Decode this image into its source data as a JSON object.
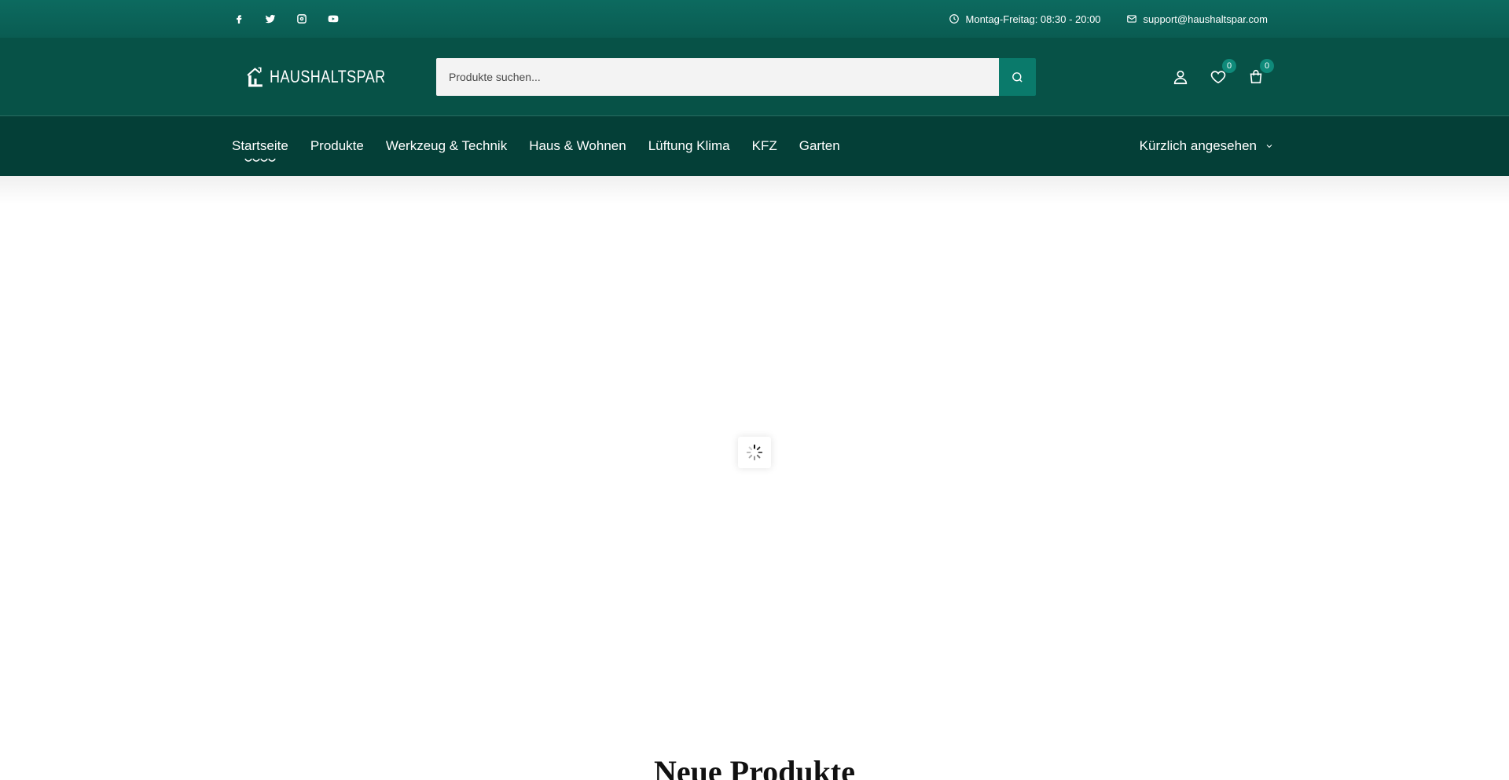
{
  "topbar": {
    "socials": [
      "facebook-icon",
      "twitter-icon",
      "instagram-icon",
      "youtube-icon"
    ],
    "hours": "Montag-Freitag: 08:30 - 20:00",
    "email": "support@haushaltspar.com"
  },
  "header": {
    "logo_text": "HAUSHALTSPAR",
    "search_placeholder": "Produkte suchen...",
    "wishlist_count": "0",
    "cart_count": "0"
  },
  "nav": {
    "items": [
      {
        "label": "Startseite",
        "active": true
      },
      {
        "label": "Produkte"
      },
      {
        "label": "Werkzeug & Technik"
      },
      {
        "label": "Haus & Wohnen"
      },
      {
        "label": "Lüftung Klima"
      },
      {
        "label": "KFZ"
      },
      {
        "label": "Garten"
      }
    ],
    "recent_label": "Kürzlich angesehen"
  },
  "main": {
    "section_title": "Neue Produkte"
  },
  "colors": {
    "topbar": "#0a5c52",
    "header": "#075247",
    "nav": "#043f37",
    "accent": "#0a7a6b"
  }
}
